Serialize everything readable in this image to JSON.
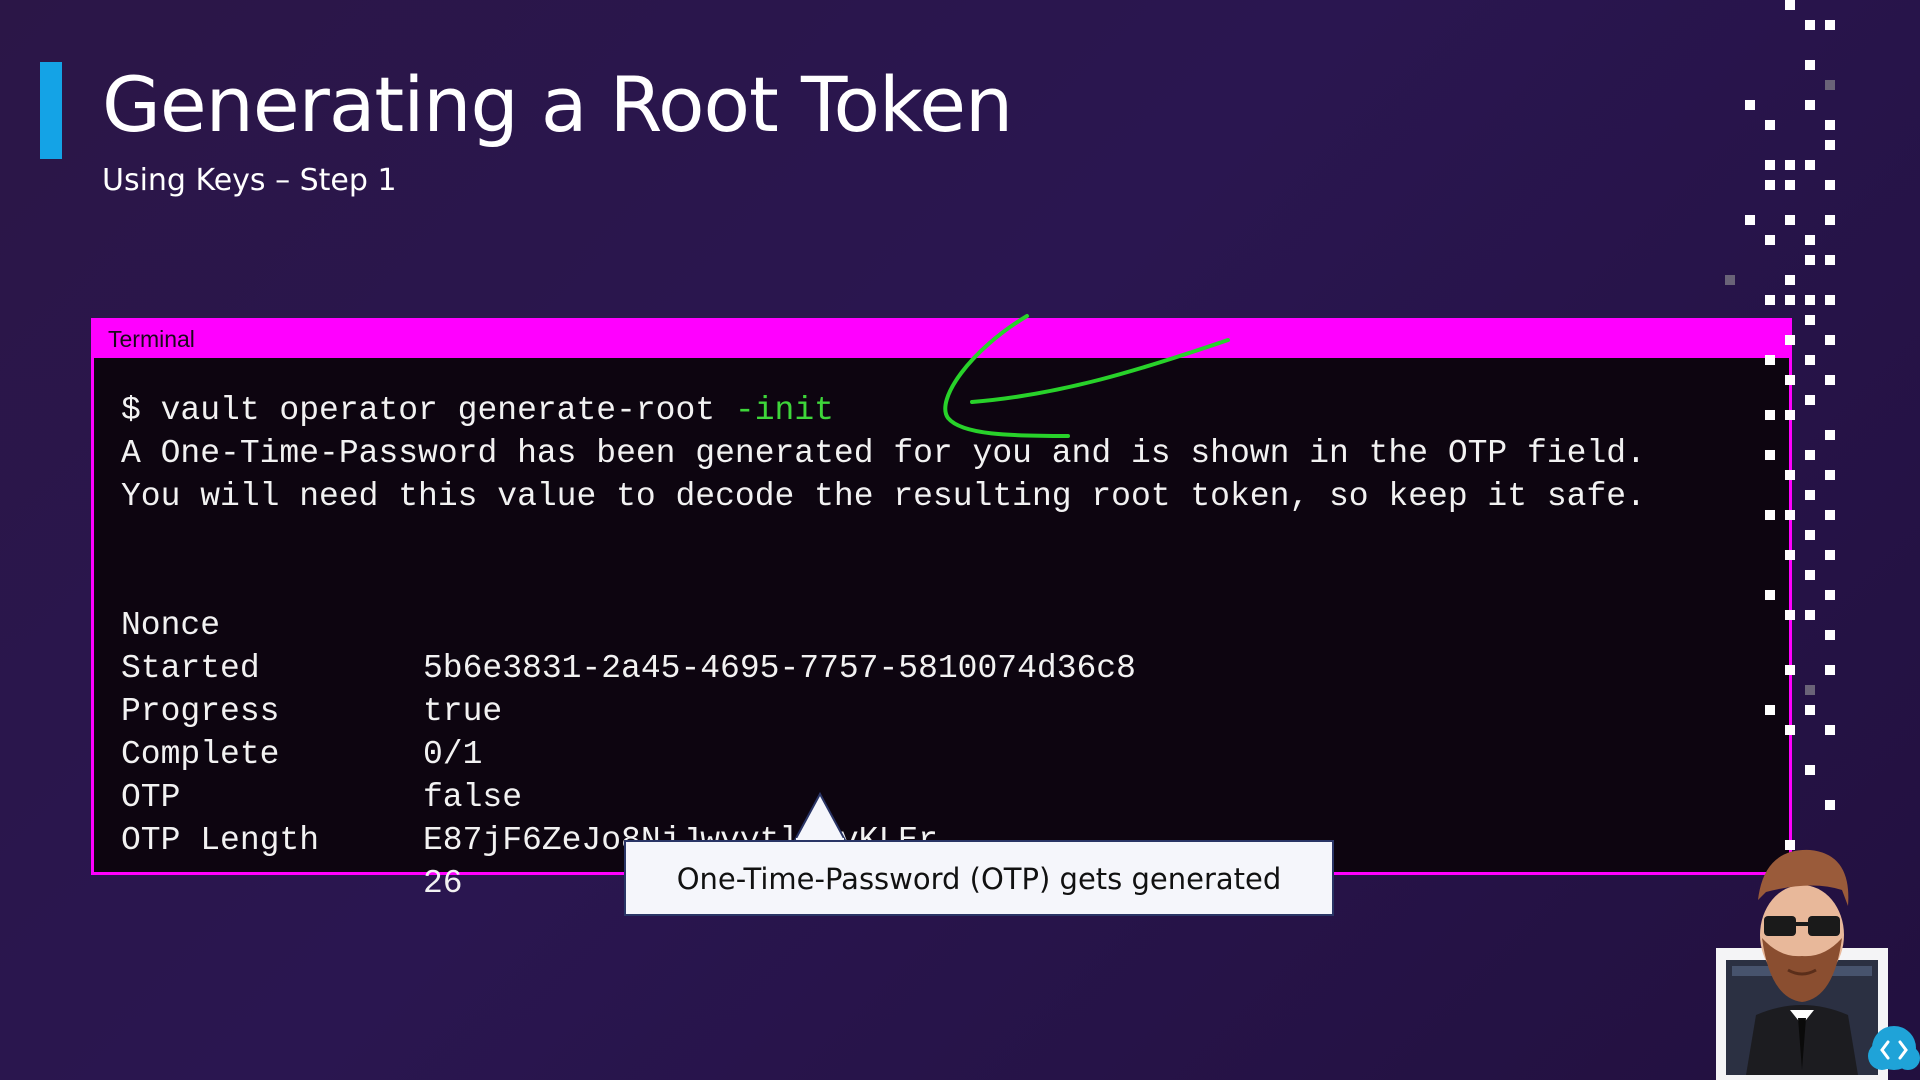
{
  "slide": {
    "title": "Generating a Root Token",
    "subtitle": "Using Keys – Step 1"
  },
  "terminal": {
    "title": "Terminal",
    "prompt": "$ vault operator generate-root ",
    "flag": "-init",
    "output_lines": [
      "A One-Time-Password has been generated for you and is shown in the OTP field.",
      "You will need this value to decode the resulting root token, so keep it safe."
    ],
    "fields": [
      {
        "key": "Nonce",
        "value": "5b6e3831-2a45-4695-7757-5810074d36c8"
      },
      {
        "key": "Started",
        "value": "true"
      },
      {
        "key": "Progress",
        "value": "0/1"
      },
      {
        "key": "Complete",
        "value": "false"
      },
      {
        "key": "OTP",
        "value": "E87jF6ZeJo8NjJwvytl7mvKLEr"
      },
      {
        "key": "OTP Length",
        "value": "26"
      }
    ]
  },
  "callout": {
    "text": "One-Time-Password (OTP) gets generated"
  },
  "colors": {
    "accent": "#14a3e6",
    "terminal_border": "#ff00ff",
    "annotation_green": "#28d22a",
    "background": "#2a1650"
  },
  "icons": {
    "mascot": "bearded-developer-avatar-icon",
    "cloud_logo": "cloud-code-icon"
  }
}
